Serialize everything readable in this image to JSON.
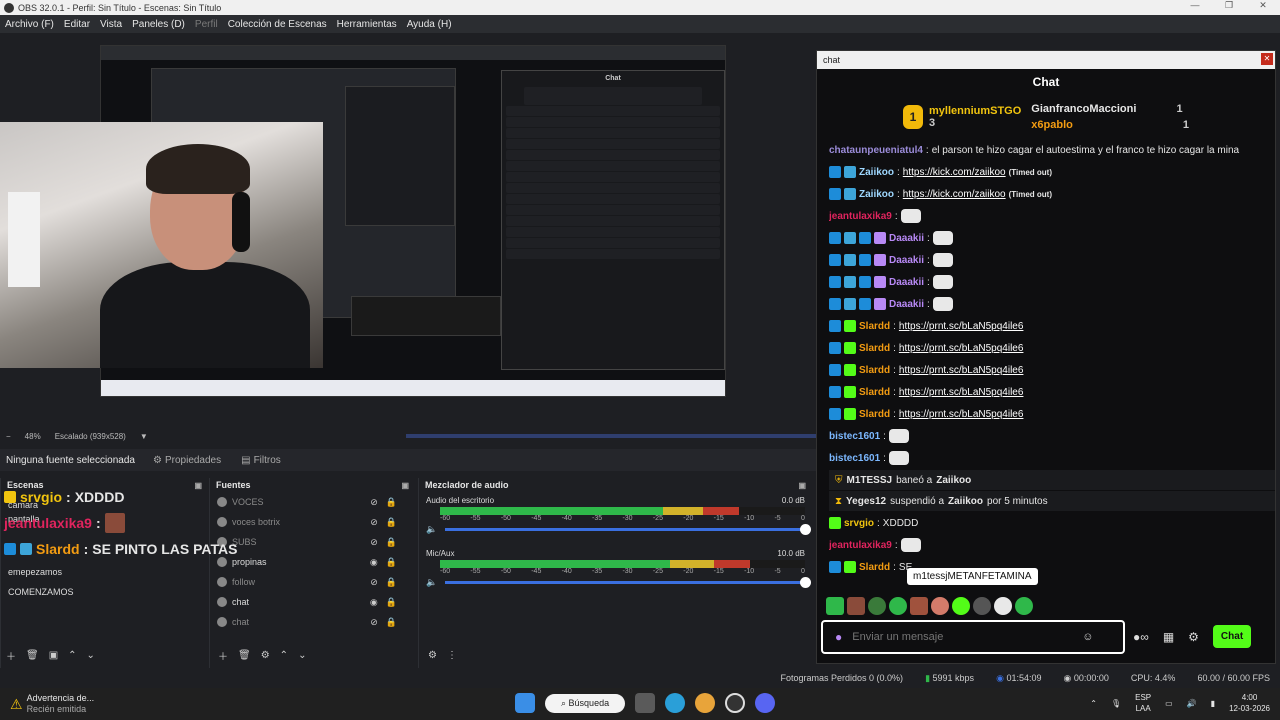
{
  "window": {
    "title": "OBS 32.0.1 - Perfil: Sin Título - Escenas: Sin Título",
    "controls": [
      "—",
      "❐",
      "✕"
    ]
  },
  "menu": [
    "Archivo (F)",
    "Editar",
    "Vista",
    "Paneles (D)",
    "Perfil",
    "Colección de Escenas",
    "Herramientas",
    "Ayuda (H)"
  ],
  "preview": {
    "zoom": "48%",
    "scale": "Escalado (939x528)"
  },
  "props": {
    "no_source": "Ninguna fuente seleccionada",
    "properties": "Propiedades",
    "filters": "Filtros"
  },
  "scenes": {
    "title": "Escenas",
    "items": [
      "camara",
      "pantalla",
      "",
      "emepezamos",
      "COMENZAMOS"
    ]
  },
  "overlay": [
    {
      "user": "srvgio",
      "text": "XDDDD",
      "color": "#f1c40f"
    },
    {
      "user": "jeantulaxika9",
      "text": "",
      "color": "#e0245e"
    },
    {
      "user": "Slardd",
      "text": "SE PINTO LAS PATAS",
      "color": "#f39c12"
    }
  ],
  "sources": {
    "title": "Fuentes",
    "items": [
      {
        "label": "VOCES",
        "dim": true,
        "eye": "⊘"
      },
      {
        "label": "voces botrix",
        "dim": true,
        "eye": "⊘"
      },
      {
        "label": "SUBS",
        "dim": true,
        "eye": "⊘"
      },
      {
        "label": "propinas",
        "dim": false,
        "eye": "◉"
      },
      {
        "label": "follow",
        "dim": true,
        "eye": "⊘"
      },
      {
        "label": "chat",
        "dim": false,
        "eye": "◉"
      },
      {
        "label": "chat",
        "dim": true,
        "eye": "⊘"
      }
    ]
  },
  "mixer": {
    "title": "Mezclador de audio",
    "tracks": [
      {
        "name": "Audio del escritorio",
        "db": "0.0 dB",
        "level": 0.82
      },
      {
        "name": "Mic/Aux",
        "db": "10.0 dB",
        "level": 0.85
      }
    ],
    "ticks": [
      "-60",
      "-55",
      "-50",
      "-45",
      "-40",
      "-35",
      "-30",
      "-25",
      "-20",
      "-15",
      "-10",
      "-5",
      "0"
    ]
  },
  "chat": {
    "window_title": "chat",
    "title": "Chat",
    "leaders": [
      {
        "rank": "1",
        "name": "myllenniumSTGO",
        "count": "3"
      },
      {
        "name": "GianfrancoMaccioni",
        "count": "1"
      },
      {
        "name": "x6pablo",
        "count": "1"
      }
    ],
    "messages": [
      {
        "user": "chataunpeueniatul4",
        "text": "el parson te hizo cagar el autoestima y el franco te hizo cagar la mina",
        "color": "#9b8cd9"
      },
      {
        "user": "Zaiikoo",
        "text": "https://kick.com/zaiikoo",
        "tag": "(Timed out)",
        "color": "#9fd8ff"
      },
      {
        "user": "Zaiikoo",
        "text": "https://kick.com/zaiikoo",
        "tag": "(Timed out)",
        "color": "#9fd8ff"
      },
      {
        "user": "jeantulaxika9",
        "text": "",
        "color": "#e0245e"
      },
      {
        "user": "Daaakii",
        "text": "",
        "color": "#b889f6"
      },
      {
        "user": "Daaakii",
        "text": "",
        "color": "#b889f6"
      },
      {
        "user": "Daaakii",
        "text": "",
        "color": "#b889f6"
      },
      {
        "user": "Daaakii",
        "text": "",
        "color": "#b889f6"
      },
      {
        "user": "Slardd",
        "text": "https://prnt.sc/bLaN5pq4ile6",
        "color": "#f39c12"
      },
      {
        "user": "Slardd",
        "text": "https://prnt.sc/bLaN5pq4ile6",
        "color": "#f39c12"
      },
      {
        "user": "Slardd",
        "text": "https://prnt.sc/bLaN5pq4ile6",
        "color": "#f39c12"
      },
      {
        "user": "Slardd",
        "text": "https://prnt.sc/bLaN5pq4ile6",
        "color": "#f39c12"
      },
      {
        "user": "Slardd",
        "text": "https://prnt.sc/bLaN5pq4ile6",
        "color": "#f39c12"
      },
      {
        "user": "bistec1601",
        "text": "",
        "color": "#7cb8ff"
      },
      {
        "user": "bistec1601",
        "text": "",
        "color": "#7cb8ff"
      }
    ],
    "system": [
      {
        "actor": "M1TESSJ",
        "action": "baneó a",
        "target": "Zaiikoo",
        "suffix": ""
      },
      {
        "actor": "Yeges12",
        "action": "suspendió a",
        "target": "Zaiikoo",
        "suffix": "por 5 minutos"
      }
    ],
    "after": [
      {
        "user": "srvgio",
        "text": "XDDDD",
        "color": "#f1c40f"
      },
      {
        "user": "jeantulaxika9",
        "text": "",
        "color": "#e0245e"
      },
      {
        "user": "Slardd",
        "text": "SE",
        "color": "#f39c12"
      }
    ],
    "tooltip": "m1tessjMETANFETAMINA",
    "input_placeholder": "Enviar un mensaje",
    "send": "Chat"
  },
  "status": {
    "frames": "Fotogramas Perdidos 0 (0.0%)",
    "kbps": "5991 kbps",
    "live": "01:54:09",
    "rec": "00:00:00",
    "cpu": "CPU: 4.4%",
    "fps": "60.00 / 60.00 FPS"
  },
  "taskbar": {
    "warning_title": "Advertencia de...",
    "warning_sub": "Recién emitida",
    "search": "Búsqueda",
    "lang": "ESP",
    "lang_sub": "LAA",
    "time": "4:00",
    "date": "12-03-2026"
  },
  "colors": {
    "kick_green": "#53fc18",
    "accent_blue": "#3a6fe0"
  }
}
